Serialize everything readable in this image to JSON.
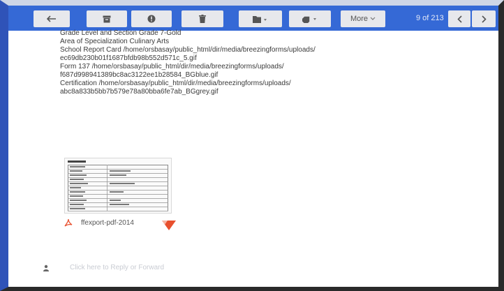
{
  "toolbar": {
    "more_label": "More",
    "counter": "9 of 213"
  },
  "email": {
    "lines": [
      "Grade Level and Section  Grade 7-Gold",
      "Area of Specialization  Culinary Arts",
      "School Report Card  /home/orsbasay/public_html/dir/media/breezingforms/uploads/",
      "ec69db230b01f1687bfdb98b552d571c_5.gif",
      "Form 137  /home/orsbasay/public_html/dir/media/breezingforms/uploads/",
      "f687d998941389bc8ac3122ee1b28584_BGblue.gif",
      "Certification  /home/orsbasay/public_html/dir/media/breezingforms/uploads/",
      "abc8a833b5bb7b579e78a80bba6fe7ab_BGgrey.gif"
    ]
  },
  "attachment": {
    "filename": "ffexport-pdf-2014"
  },
  "reply_bar": {
    "text": "Click here to Reply or Forward"
  },
  "colors": {
    "toolbar_bg": "#3569d6",
    "button_bg": "#e7e8ec",
    "pdf_red": "#e8502e"
  }
}
